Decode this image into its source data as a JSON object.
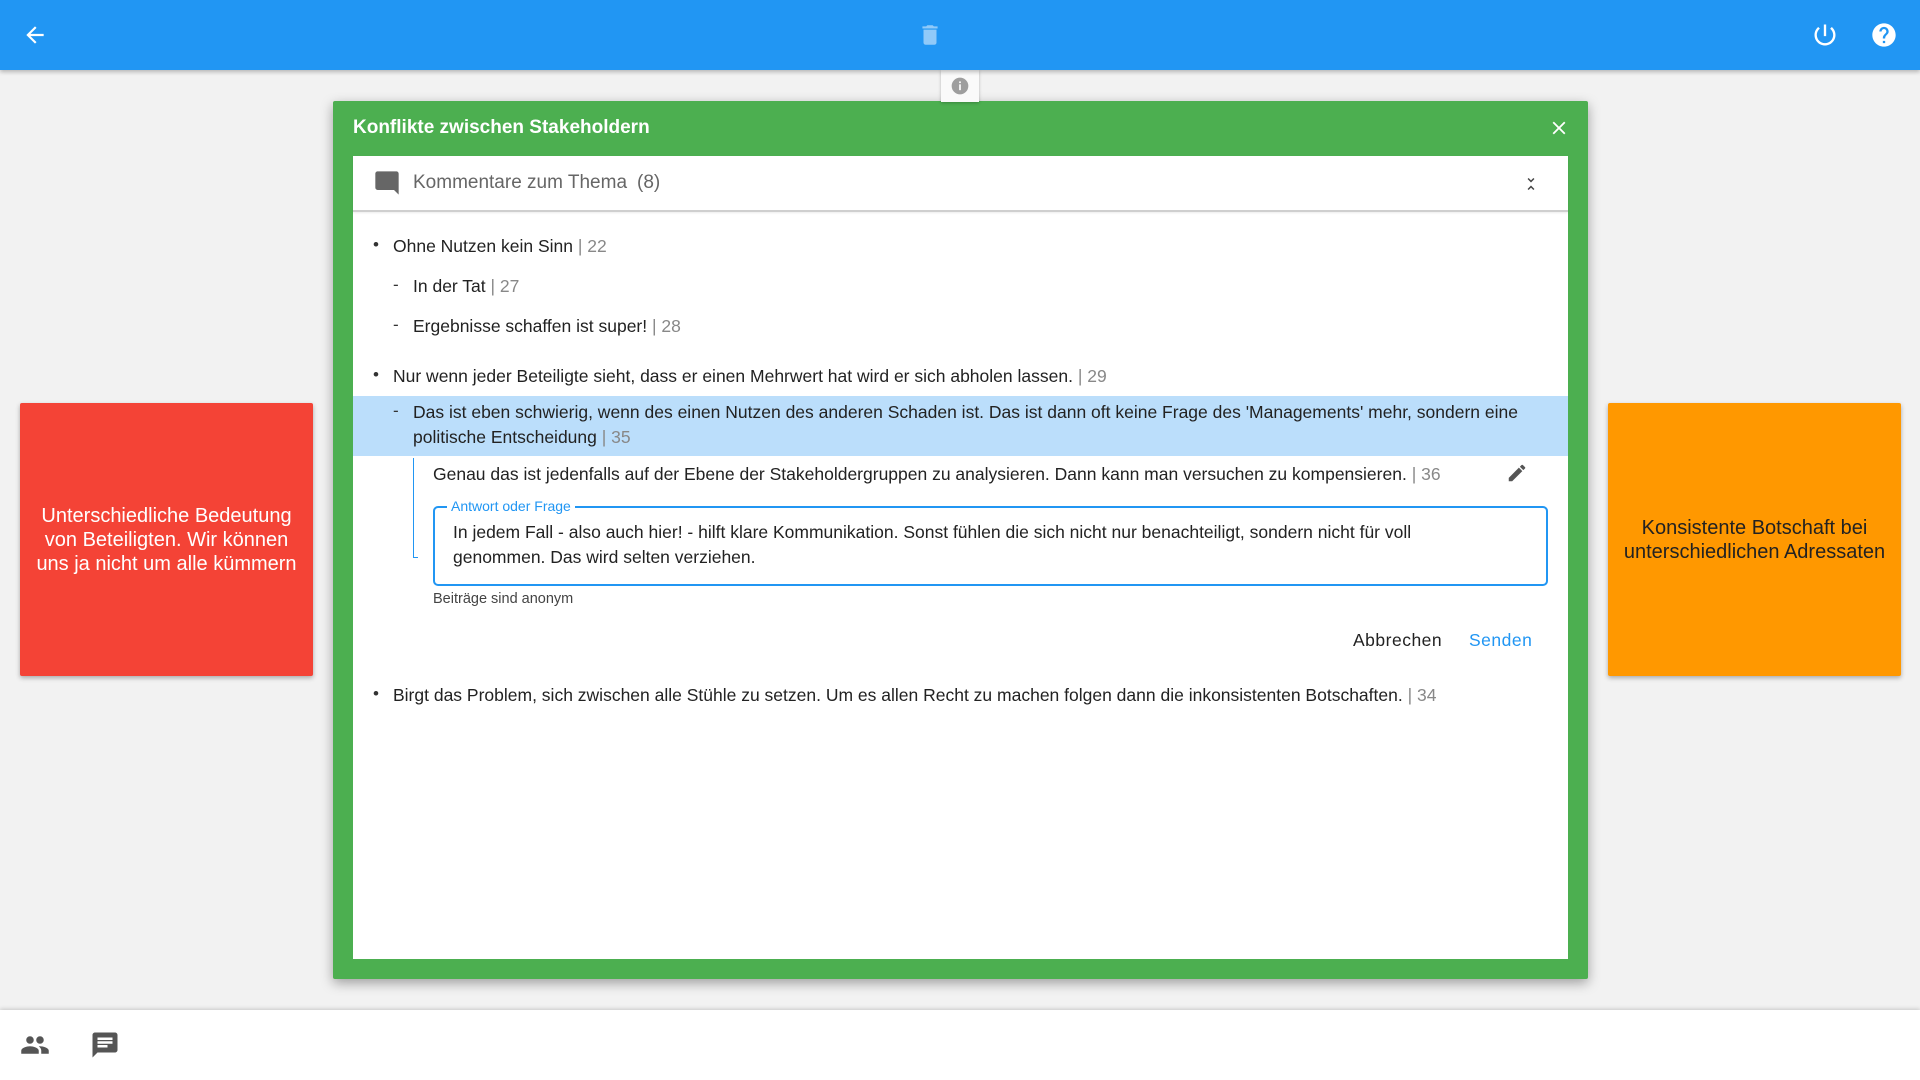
{
  "topbar": {
    "back_icon": "arrow-left-icon",
    "trash_icon": "trash-icon",
    "power_icon": "power-icon",
    "help_icon": "help-icon",
    "color": "#2196f3"
  },
  "info_tab": {
    "icon": "info-icon"
  },
  "stickies": {
    "left": {
      "text": "Unterschiedliche Bedeutung von Beteiligten. Wir können uns ja nicht um alle kümmern",
      "color": "#f44336"
    },
    "right": {
      "text": "Konsistente Botschaft bei unterschiedlichen Adressaten",
      "color": "#ff9800"
    }
  },
  "dialog": {
    "title": "Konflikte zwischen Stakeholdern",
    "color": "#4caf50",
    "comments_header": {
      "title": "Kommentare zum Thema",
      "count": "(8)"
    },
    "comments": [
      {
        "marker": "•",
        "text": "Ohne Nutzen kein Sinn",
        "num": "| 22"
      },
      {
        "marker": "-",
        "text": "In der Tat",
        "num": "| 27"
      },
      {
        "marker": "-",
        "text": "Ergebnisse schaffen ist super!",
        "num": "| 28"
      },
      {
        "marker": "•",
        "text": "Nur wenn jeder Beteiligte sieht, dass er einen Mehrwert hat wird er sich abholen lassen.",
        "num": "| 29"
      },
      {
        "marker": "-",
        "text": "Das ist eben schwierig, wenn des einen Nutzen des anderen Schaden ist. Das ist dann oft keine Frage des 'Managements' mehr, sondern eine politische Entscheidung",
        "num": "| 35"
      },
      {
        "marker": "",
        "text": "Genau das ist jedenfalls auf der Ebene der Stakeholdergruppen zu analysieren. Dann kann man versuchen zu kompensieren.",
        "num": "| 36"
      },
      {
        "marker": "•",
        "text": "Birgt das Problem, sich zwischen alle Stühle zu setzen. Um es allen Recht zu machen folgen dann die inkonsistenten Botschaften.",
        "num": "| 34"
      }
    ],
    "reply": {
      "label": "Antwort oder Frage",
      "value": "In jedem Fall - also auch hier! - hilft klare Kommunikation. Sonst fühlen die sich nicht nur benachteiligt, sondern nicht für voll genommen. Das wird selten verziehen.",
      "hint": "Beiträge sind anonym",
      "cancel": "Abbrechen",
      "send": "Senden"
    }
  },
  "bottombar": {
    "people_icon": "people-icon",
    "chat_icon": "chat-icon"
  }
}
